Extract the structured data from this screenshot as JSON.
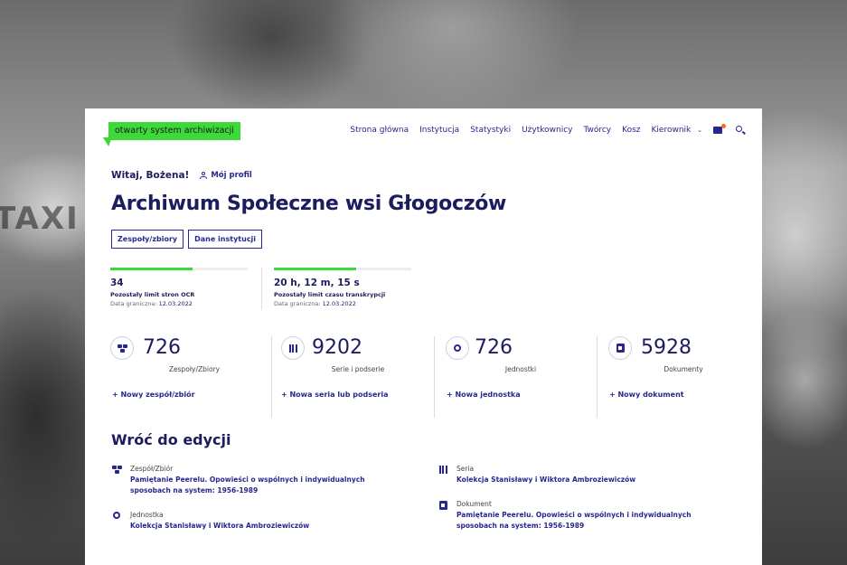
{
  "background": {
    "sign_text": "TAXI"
  },
  "header": {
    "logo_text": "otwarty system archiwizacji",
    "nav": [
      "Strona główna",
      "Instytucja",
      "Statystyki",
      "Użytkownicy",
      "Twórcy",
      "Kosz"
    ],
    "user_menu": "Kierownik",
    "icons": [
      "chevron-down-icon",
      "chat-icon",
      "search-icon"
    ]
  },
  "greeting": {
    "hello": "Witaj, Bożena!",
    "profile": "Mój profil"
  },
  "page_title": "Archiwum Społeczne wsi Głogoczów",
  "tabs": [
    "Zespoły/zbiory",
    "Dane instytucji"
  ],
  "limits": [
    {
      "value": "34",
      "label": "Pozostały limit stron OCR",
      "date_label": "Data graniczna:",
      "date": "12.03.2022",
      "fill": 0.6
    },
    {
      "value": "20 h, 12 m, 15 s",
      "label": "Pozostały limit czasu transkrypcji",
      "date_label": "Data graniczna:",
      "date": "12.03.2022",
      "fill": 0.6
    }
  ],
  "stats": [
    {
      "icon": "tree-icon",
      "count": "726",
      "label": "Zespoły/Zbiory",
      "add": "+ Nowy zespół/zbiór"
    },
    {
      "icon": "bars-icon",
      "count": "9202",
      "label": "Serie i podserie",
      "add": "+ Nowa seria lub podseria"
    },
    {
      "icon": "ring-icon",
      "count": "726",
      "label": "Jednostki",
      "add": "+ Nowa jednostka"
    },
    {
      "icon": "document-icon",
      "count": "5928",
      "label": "Dokumenty",
      "add": "+ Nowy dokument"
    }
  ],
  "back_to_edit": {
    "title": "Wróć do edycji",
    "items": [
      {
        "icon": "tree-icon",
        "category": "Zespół/Zbiór",
        "link": "Pamiętanie Peerelu. Opowieści o wspólnych i indywidualnych sposobach na system: 1956-1989"
      },
      {
        "icon": "ring-icon",
        "category": "Jednostka",
        "link": "Kolekcja Stanisławy i Wiktora Ambroziewiczów"
      },
      {
        "icon": "bars-icon",
        "category": "Seria",
        "link": "Kolekcja Stanisławy i Wiktora Ambroziewiczów"
      },
      {
        "icon": "document-icon",
        "category": "Dokument",
        "link": "Pamiętanie Peerelu. Opowieści o wspólnych i indywidualnych sposobach na system: 1956-1989"
      }
    ]
  },
  "colors": {
    "accent_green": "#3dd93a",
    "navy": "#1c1c5e",
    "link_blue": "#27278f",
    "notification": "#ff6a1a"
  }
}
